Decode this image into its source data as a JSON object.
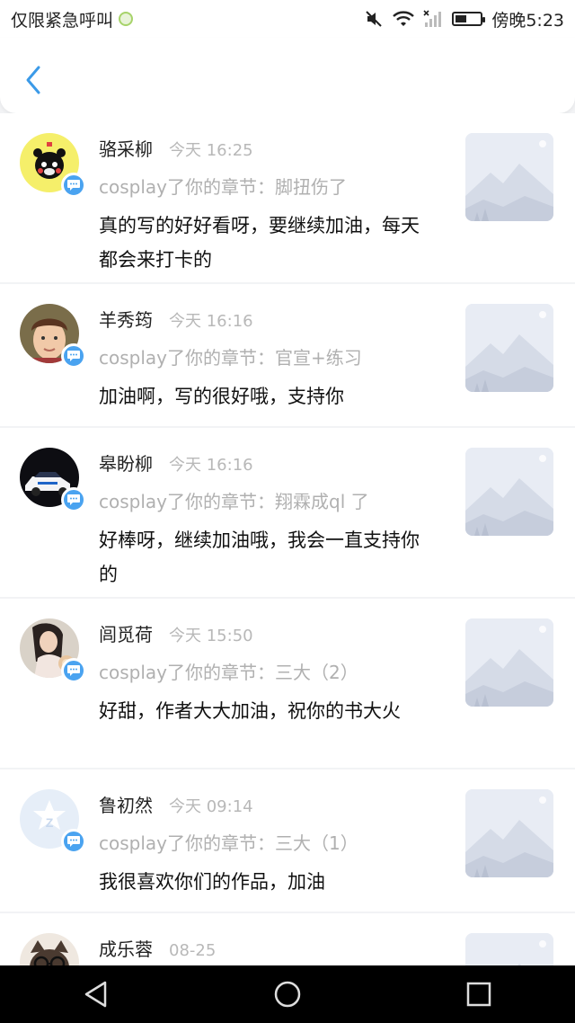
{
  "status_bar": {
    "carrier": "仅限紧急呼叫",
    "time": "傍晚5:23",
    "battery_level": 0.45,
    "icons": [
      "mute-icon",
      "wifi-icon",
      "signal-icon",
      "battery-icon"
    ]
  },
  "header": {
    "back_icon": "chevron-left-icon"
  },
  "colors": {
    "accent": "#3b9ae8",
    "badge": "#4aa3f0",
    "muted_text": "#b0b0b0",
    "background": "#f2f3f5"
  },
  "notifications": [
    {
      "name": "骆采柳",
      "time": "今天 16:25",
      "chapter": "cosplay了你的章节：脚扭伤了",
      "comment": "真的写的好好看呀，要继续加油，每天都会来打卡的",
      "avatar": "kumamon-avatar"
    },
    {
      "name": "羊秀筠",
      "time": "今天 16:16",
      "chapter": "cosplay了你的章节：官宣+练习",
      "comment": "加油啊，写的很好哦，支持你",
      "avatar": "boy-avatar"
    },
    {
      "name": "皋盼柳",
      "time": "今天 16:16",
      "chapter": "cosplay了你的章节：翔霖成ql 了",
      "comment": "好棒呀，继续加油哦，我会一直支持你的",
      "avatar": "car-avatar"
    },
    {
      "name": "闾觅荷",
      "time": "今天 15:50",
      "chapter": "cosplay了你的章节：三大（2）",
      "comment": "好甜，作者大大加油，祝你的书大火",
      "avatar": "girl-avatar"
    },
    {
      "name": "鲁初然",
      "time": "今天 09:14",
      "chapter": "cosplay了你的章节：三大（1）",
      "comment": "我很喜欢你们的作品，加油",
      "avatar": "default-qq-avatar"
    },
    {
      "name": "成乐蓉",
      "time": "08-25",
      "chapter": "",
      "comment": "",
      "avatar": "cat-glasses-avatar"
    }
  ],
  "nav_bar": {
    "icons": [
      "back-triangle-icon",
      "home-circle-icon",
      "recents-square-icon"
    ]
  }
}
